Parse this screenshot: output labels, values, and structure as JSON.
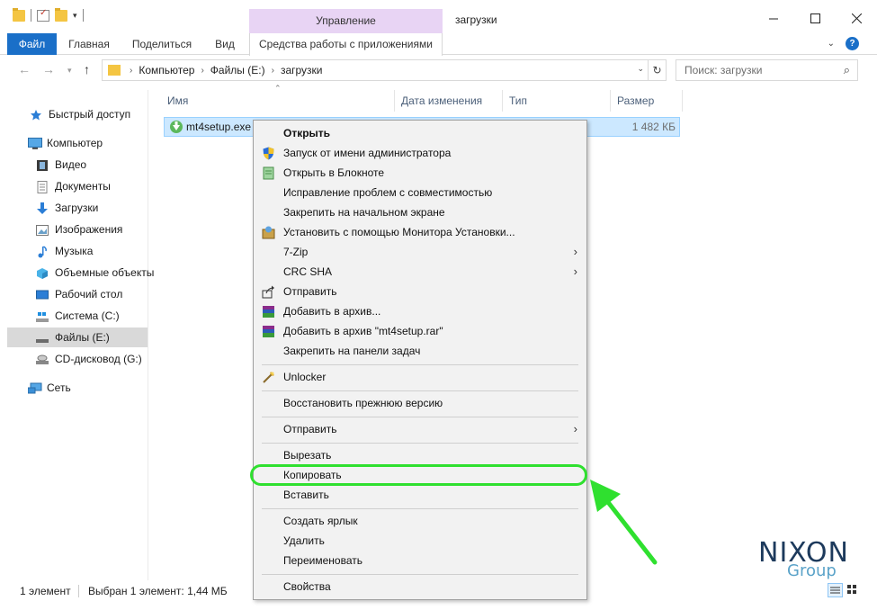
{
  "window": {
    "context_tab": "Управление",
    "title": "загрузки",
    "minimize_icon": "minimize-icon",
    "maximize_icon": "maximize-icon",
    "close_icon": "close-icon"
  },
  "ribbon": {
    "tabs": [
      "Файл",
      "Главная",
      "Поделиться",
      "Вид",
      "Средства работы с приложениями"
    ],
    "expand_icon": "chevron-down-icon",
    "help_icon": "?"
  },
  "address": {
    "crumbs": [
      "Компьютер",
      "Файлы (E:)",
      "загрузки"
    ],
    "search_placeholder": "Поиск: загрузки"
  },
  "nav": {
    "items": [
      {
        "label": "Быстрый доступ",
        "icon": "star-icon"
      },
      {
        "label": "Компьютер",
        "icon": "computer-icon"
      },
      {
        "label": "Видео",
        "icon": "video-icon"
      },
      {
        "label": "Документы",
        "icon": "documents-icon"
      },
      {
        "label": "Загрузки",
        "icon": "download-icon"
      },
      {
        "label": "Изображения",
        "icon": "images-icon"
      },
      {
        "label": "Музыка",
        "icon": "music-icon"
      },
      {
        "label": "Объемные объекты",
        "icon": "3d-objects-icon"
      },
      {
        "label": "Рабочий стол",
        "icon": "desktop-icon"
      },
      {
        "label": "Система (C:)",
        "icon": "drive-icon"
      },
      {
        "label": "Файлы (E:)",
        "icon": "drive-icon"
      },
      {
        "label": "CD-дисковод (G:)",
        "icon": "cd-drive-icon"
      },
      {
        "label": "Сеть",
        "icon": "network-icon"
      }
    ],
    "selected": "Файлы (E:)"
  },
  "columns": [
    "Имя",
    "Дата изменения",
    "Тип",
    "Размер"
  ],
  "file": {
    "name": "mt4setup.exe",
    "size": "1 482 КБ",
    "icon": "installer-icon"
  },
  "context_menu": {
    "items": [
      {
        "label": "Открыть",
        "bold": true
      },
      {
        "label": "Запуск от имени администратора",
        "icon": "shield-icon"
      },
      {
        "label": "Открыть в Блокноте",
        "icon": "notepad-icon"
      },
      {
        "label": "Исправление проблем с совместимостью"
      },
      {
        "label": "Закрепить на начальном экране"
      },
      {
        "label": "Установить с помощью Монитора Установки...",
        "icon": "install-monitor-icon"
      },
      {
        "label": "7-Zip",
        "submenu": true
      },
      {
        "label": "CRC SHA",
        "submenu": true
      },
      {
        "label": "Отправить",
        "icon": "share-icon"
      },
      {
        "label": "Добавить в архив...",
        "icon": "winrar-icon"
      },
      {
        "label": "Добавить в архив \"mt4setup.rar\"",
        "icon": "winrar-icon"
      },
      {
        "label": "Закрепить на панели задач"
      },
      {
        "label": "Unlocker",
        "icon": "unlocker-icon"
      },
      {
        "label": "Восстановить прежнюю версию"
      },
      {
        "label": "Отправить",
        "submenu": true
      },
      {
        "label": "Вырезать"
      },
      {
        "label": "Копировать",
        "highlighted": true
      },
      {
        "label": "Вставить"
      },
      {
        "label": "Создать ярлык"
      },
      {
        "label": "Удалить"
      },
      {
        "label": "Переименовать"
      },
      {
        "label": "Свойства"
      }
    ],
    "submenu_arrow": "›"
  },
  "status": {
    "count": "1 элемент",
    "selected": "Выбран 1 элемент: 1,44 МБ"
  },
  "watermark": {
    "line1": "NIXON",
    "line2": "Group"
  },
  "colors": {
    "accent": "#1a6fc8",
    "context_tab": "#e8d4f4",
    "selection": "#cce8ff",
    "highlight_ring": "#2fe02f",
    "arrow": "#2fe02f"
  }
}
